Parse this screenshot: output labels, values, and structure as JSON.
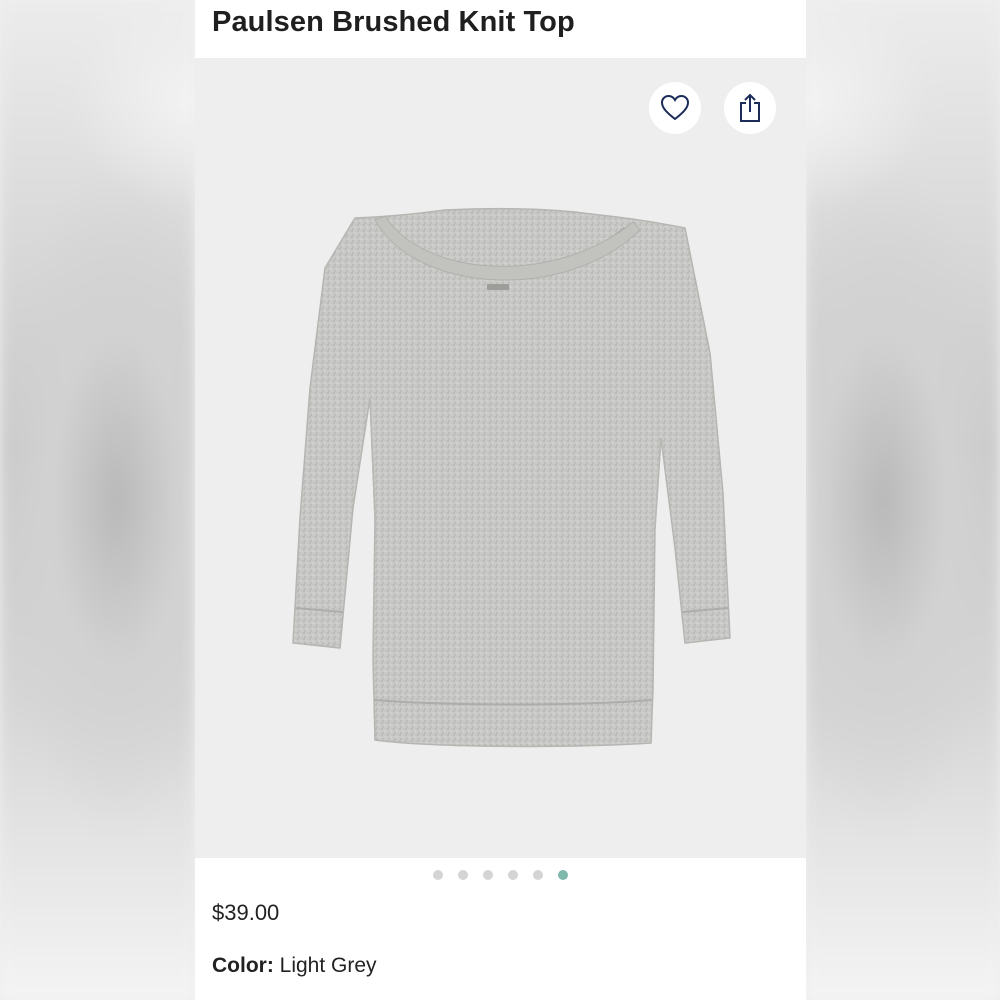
{
  "product": {
    "title": "Paulsen Brushed Knit Top",
    "price": "$39.00",
    "color_label": "Color:",
    "color_value": "Light Grey"
  },
  "gallery": {
    "image_count": 6,
    "active_index": 5,
    "active_dot_color": "#7fb8ad",
    "inactive_dot_color": "#d4d4d4",
    "background_color": "#eeeeee"
  },
  "actions": {
    "favorite_icon": "heart-icon",
    "share_icon": "share-icon",
    "icon_color": "#1c2c5a"
  }
}
